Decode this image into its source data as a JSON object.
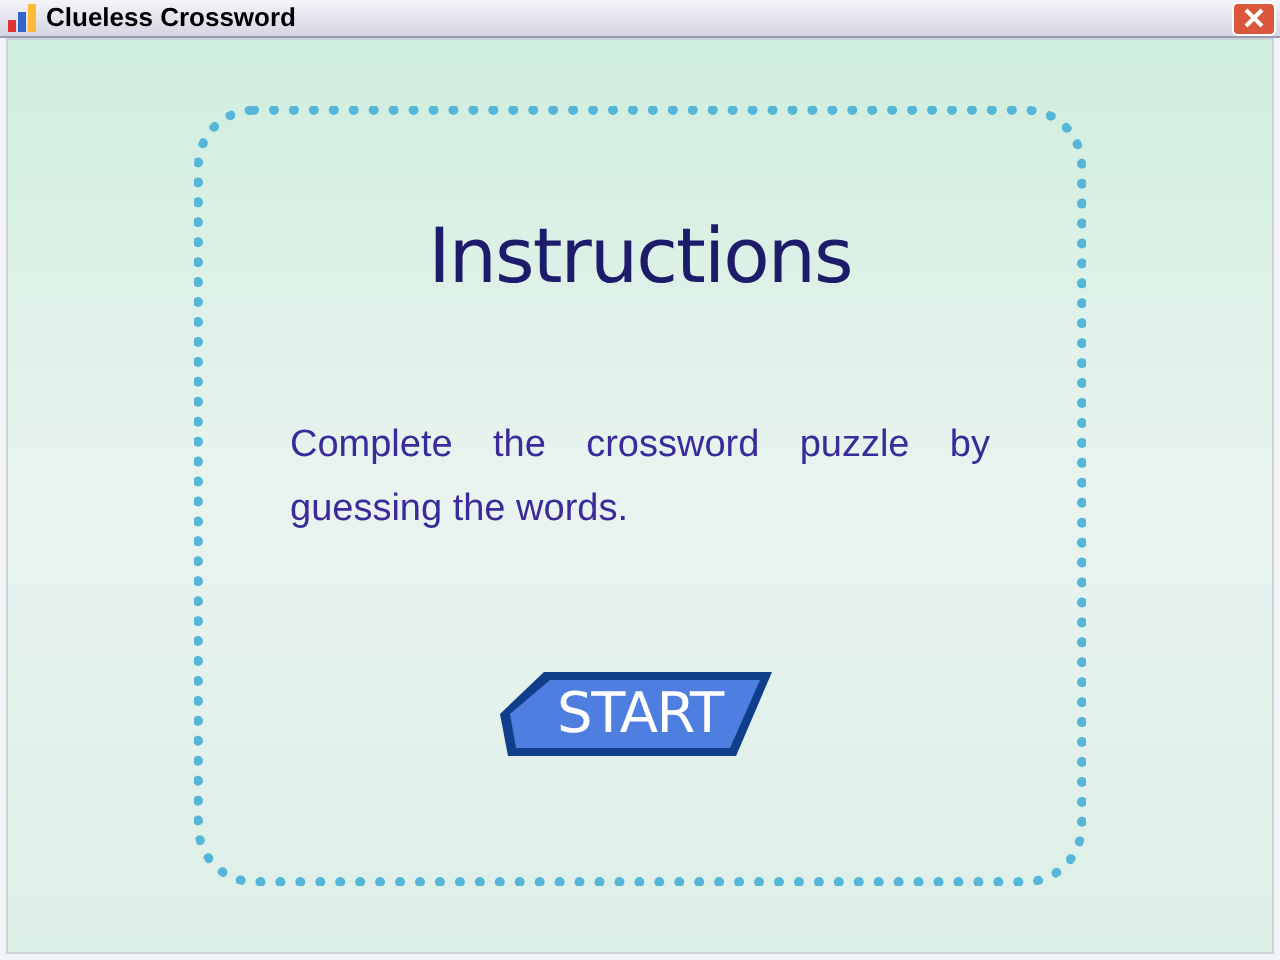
{
  "window": {
    "title": "Clueless Crossword"
  },
  "panel": {
    "heading": "Instructions",
    "text": "Complete the crossword puzzle by guessing the words."
  },
  "start_button": {
    "label": "START"
  }
}
